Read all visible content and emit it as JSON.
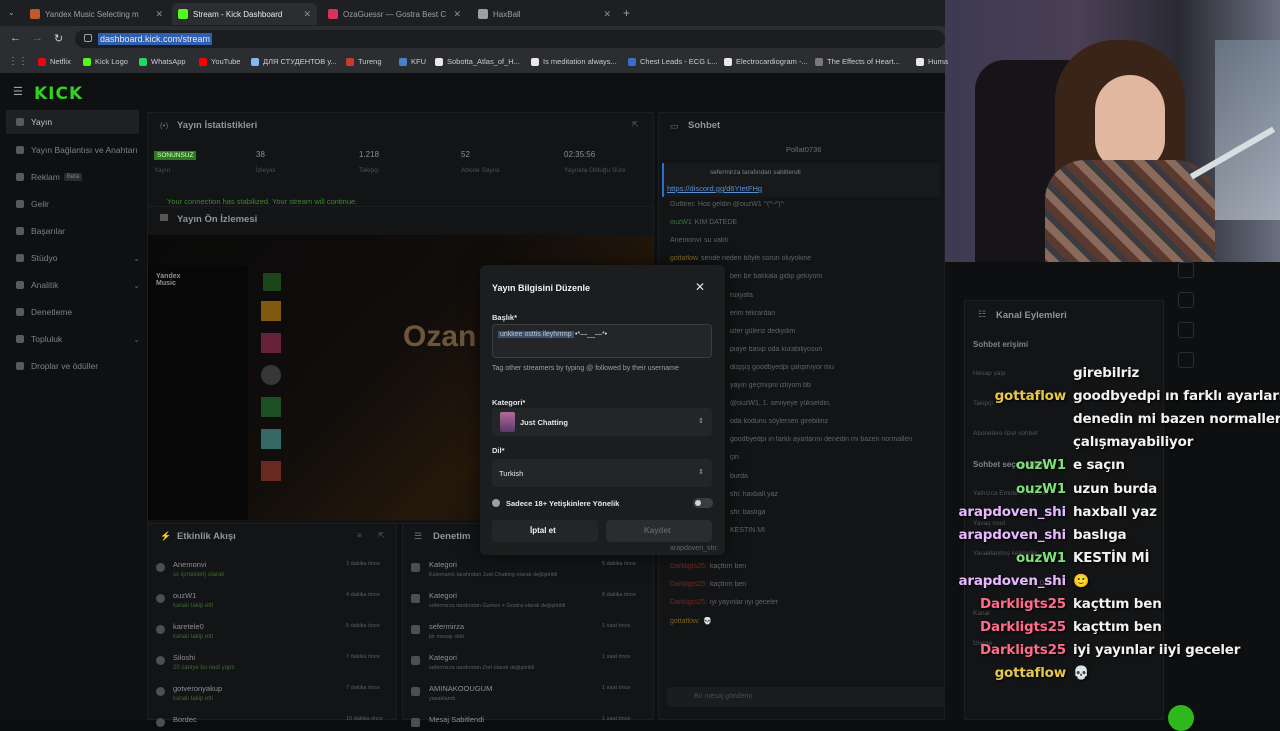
{
  "browser": {
    "tabs": [
      {
        "title": "Yandex Music Selecting m",
        "color": "#c05a2a",
        "active": false
      },
      {
        "title": "Stream - Kick Dashboard",
        "color": "#53fc18",
        "active": true
      },
      {
        "title": "OzaGuessr — Gostra Best C",
        "color": "#d6335a",
        "active": false
      },
      {
        "title": "HaxBall",
        "color": "#9aa0a6",
        "active": false
      }
    ],
    "url": "dashboard.kick.com/stream",
    "bookmarks": [
      "Netflix",
      "Kick Logo",
      "WhatsApp",
      "YouTube",
      "ДЛЯ СТУДЕНТОВ у...",
      "Tureng",
      "KFU",
      "Sobotta_Atlas_of_H...",
      "Is meditation always...",
      "Chest Leads - ECG L...",
      "Electrocardiogram -...",
      "The Effects of Heart...",
      "Huma"
    ]
  },
  "dashboard": {
    "logo": "KICK",
    "nav": [
      {
        "label": "Yayın",
        "selected": true,
        "chev": false
      },
      {
        "label": "Yayın Bağlantısı ve Anahtarı",
        "selected": false,
        "chev": false
      },
      {
        "label": "Reklam",
        "badge": "Beta",
        "selected": false,
        "chev": false
      },
      {
        "label": "Gelir",
        "selected": false,
        "chev": false
      },
      {
        "label": "Başarılar",
        "selected": false,
        "chev": false
      },
      {
        "label": "Stüdyo",
        "selected": false,
        "chev": true
      },
      {
        "label": "Analitik",
        "selected": false,
        "chev": true
      },
      {
        "label": "Denetleme",
        "selected": false,
        "chev": false
      },
      {
        "label": "Topluluk",
        "selected": false,
        "chev": true
      },
      {
        "label": "Droplar ve ödüller",
        "selected": false,
        "chev": false
      }
    ],
    "stats_title": "Yayın İstatistikleri",
    "stats": [
      {
        "value": "SONUNSUZ",
        "label": "Yayın"
      },
      {
        "value": "38",
        "label": "İzleyici"
      },
      {
        "value": "1.218",
        "label": "Takipçi"
      },
      {
        "value": "52",
        "label": "Abone Sayısı"
      },
      {
        "value": "02:35:56",
        "label": "Yayında Olduğu Süre"
      }
    ],
    "connection_msg": "Your connection has stabilized. Your stream will continue.",
    "preview_title": "Yayın Ön İzlemesi",
    "preview_overlay_text": "Ozan",
    "activity_title": "Etkinlik Akışı",
    "activity": [
      {
        "user": "Anemonvi",
        "text": "ss içmekleri) olarak",
        "time": "3 dakika önce"
      },
      {
        "user": "ouzW1",
        "text": "kanalı takip etti",
        "time": "4 dakika önce"
      },
      {
        "user": "karetele0",
        "text": "kanalı takip etti",
        "time": "5 dakika önce"
      },
      {
        "user": "Siloshi",
        "text": "20 saniye bu nedi yaptı",
        "time": "7 dakika önce"
      },
      {
        "user": "gotveronyakup",
        "text": "kanalı takip etti",
        "time": "7 dakika önce"
      },
      {
        "user": "Bordec",
        "text": "",
        "time": "10 dakika önce"
      }
    ],
    "moderation_title": "Denetim",
    "moderation": [
      {
        "user": "Kategori",
        "text": "Kalemarck tarafından Just Chatting olarak değiştirildi",
        "time": "5 dakika önce"
      },
      {
        "user": "Kategori",
        "text": "sefermirza tarafından Games + Gostra olarak değiştirildi",
        "time": "8 dakika önce"
      },
      {
        "user": "sefermirza",
        "text": "bir mesajı sildi",
        "time": "1 saat önce"
      },
      {
        "user": "Kategori",
        "text": "sefermirza tarafından Zorl olarak değiştirildi",
        "time": "1 saat önce"
      },
      {
        "user": "AMINAKOOUGUM",
        "text": "yasaklandı",
        "time": "1 saat önce"
      },
      {
        "user": "Mesaj Sabitlendi",
        "text": "",
        "time": "1 saat önce"
      }
    ],
    "chat_title": "Sohbet",
    "chat_pinned_user": "Pollat0736",
    "chat_pinned_by": "sefermirza tarafından sabitlendi",
    "chat_pinned_link": "https://discord.gg/d6YtetFHg",
    "chat_lines": [
      {
        "user": "Gutbrec",
        "text": "Hos geldin @ouzW1 ^(^-^)^",
        "color": "#9aa0a6"
      },
      {
        "user": "ouzW1",
        "text": "KIM DATEDE",
        "color": "#59c26b"
      },
      {
        "user": "Anemonvi",
        "text": "su vakti",
        "color": "#9aa0a6"
      },
      {
        "user": "gottaflow",
        "text": "sende neden böyle sorun oluyokine",
        "color": "#c9a227"
      },
      {
        "user": "",
        "text": "ben bir bakkala gidip gekiyom",
        "color": "#9aa0a6"
      },
      {
        "user": "",
        "text": "ruxyafa",
        "color": "#9aa0a6"
      },
      {
        "user": "",
        "text": "erim tekrardan",
        "color": "#9aa0a6"
      },
      {
        "user": "",
        "text": "izler güleriz dediydim",
        "color": "#9aa0a6"
      },
      {
        "user": "",
        "text": "piaye basıp oda kurabiliyosun",
        "color": "#9aa0a6"
      },
      {
        "user": "",
        "text": "düşşış goodbyedpi çalışmıyor mu",
        "color": "#9aa0a6"
      },
      {
        "user": "",
        "text": "yayın geçmişini izliyom bb",
        "color": "#9aa0a6"
      },
      {
        "user": "",
        "text": "@ouzW1, 1. seviyeye yükseldin.",
        "color": "#9aa0a6"
      },
      {
        "user": "",
        "text": "oda kodunu söylersen girebiliriz",
        "color": "#9aa0a6"
      },
      {
        "user": "",
        "text": "goodbyedpi ın farklı ayarlarını denedin mi bazen normalleri",
        "color": "#9aa0a6"
      },
      {
        "user": "",
        "text": "çin",
        "color": "#9aa0a6"
      },
      {
        "user": "",
        "text": "burda",
        "color": "#9aa0a6"
      },
      {
        "user": "",
        "text": "shi: haxball yaz",
        "color": "#9aa0a6"
      },
      {
        "user": "",
        "text": "shi: baslıga",
        "color": "#9aa0a6"
      },
      {
        "user": "",
        "text": "KESTİN Mİ",
        "color": "#9aa0a6"
      },
      {
        "user": "arapdoven_shi:",
        "text": "",
        "color": "#9aa0a6"
      },
      {
        "user": "Darkligts25:",
        "text": "kaçttım ben",
        "color": "#c0392b"
      },
      {
        "user": "Darkligts25:",
        "text": "kaçttım ben",
        "color": "#c0392b"
      },
      {
        "user": "Darkligts25:",
        "text": "iyi yayınlar iiyi geceler",
        "color": "#c0392b"
      },
      {
        "user": "gottaflow:",
        "text": "💀",
        "color": "#c9a227"
      }
    ],
    "chat_input_placeholder": "Bir mesaj gönderin",
    "channel_actions_title": "Kanal Eylemleri",
    "channel_actions": [
      "Sohbet erişimi",
      "Hesap yaşı",
      "Takipçi",
      "Abonelere özel sohbet",
      "Sohbet seçenekleri",
      "Yalnızca Emote ile sohbet",
      "Yavaş mod",
      "Yasaklanmış kelimeler",
      "Yapay Zeka ile Sohbet Denetimi",
      "Kanal",
      "İzleme"
    ]
  },
  "modal": {
    "title": "Yayın Bilgisini Düzenle",
    "title_label": "Başlık*",
    "title_value_selected": "unkkee osttis ileyhrrmp",
    "title_value_rest": " •*—__—*•",
    "title_hint": "Tag other streamers by typing @ followed by their username",
    "category_label": "Kategori*",
    "category_value": "Just Chatting",
    "language_label": "Dil*",
    "language_value": "Turkish",
    "mature_label": "Sadece 18+ Yetişkinlere Yönelik",
    "cancel_label": "İptal et",
    "save_label": "Kaydet"
  },
  "overlay_chat": [
    {
      "user": "",
      "text": "girebilriz",
      "color": "#ffffff",
      "emoji": ""
    },
    {
      "user": "gottaflow",
      "text": "goodbyedpi ın farklı ayarlarını",
      "color": "#e6c84a",
      "emoji": ""
    },
    {
      "user": "",
      "text": "denedin mi bazen normalleri",
      "color": "#ffffff",
      "emoji": ""
    },
    {
      "user": "",
      "text": "çalışmayabiliyor",
      "color": "#ffffff",
      "emoji": ""
    },
    {
      "user": "ouzW1",
      "text": "e saçın",
      "color": "#7fe07a",
      "emoji": ""
    },
    {
      "user": "ouzW1",
      "text": "uzun burda",
      "color": "#7fe07a",
      "emoji": ""
    },
    {
      "user": "arapdoven_shi",
      "text": "haxball yaz",
      "color": "#e7b9ff",
      "emoji": ""
    },
    {
      "user": "arapdoven_shi",
      "text": "baslıga",
      "color": "#e7b9ff",
      "emoji": ""
    },
    {
      "user": "ouzW1",
      "text": "KESTİN Mİ",
      "color": "#7fe07a",
      "emoji": ""
    },
    {
      "user": "arapdoven_shi",
      "text": "",
      "color": "#e7b9ff",
      "emoji": "🙂"
    },
    {
      "user": "Darkligts25",
      "text": "kaçttım ben",
      "color": "#ff6b8a",
      "emoji": ""
    },
    {
      "user": "Darkligts25",
      "text": "kaçttım ben",
      "color": "#ff6b8a",
      "emoji": ""
    },
    {
      "user": "Darkligts25",
      "text": "iyi yayınlar iiyi geceler",
      "color": "#ff6b8a",
      "emoji": ""
    },
    {
      "user": "gottaflow",
      "text": "",
      "color": "#e6c84a",
      "emoji": "💀"
    }
  ],
  "colors": {
    "kick_green": "#53fc18",
    "modal_bg": "#1b1d1f"
  }
}
